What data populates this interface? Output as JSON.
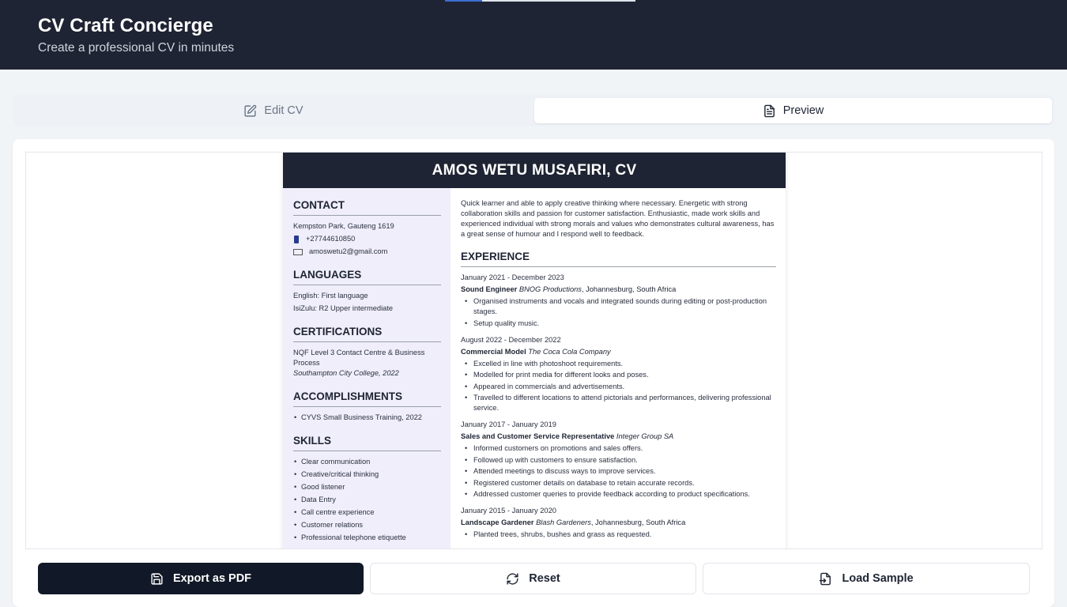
{
  "header": {
    "title": "CV Craft Concierge",
    "subtitle": "Create a professional CV in minutes"
  },
  "tabs": {
    "edit": "Edit CV",
    "preview": "Preview",
    "active": "Preview"
  },
  "cv": {
    "name": "AMOS WETU MUSAFIRI, CV",
    "contact": {
      "title": "CONTACT",
      "address": "Kempston Park, Gauteng 1619",
      "phone": "+27744610850",
      "email": "amoswetu2@gmail.com"
    },
    "languages": {
      "title": "LANGUAGES",
      "items": [
        "English: First language",
        "IsiZulu: R2 Upper intermediate"
      ]
    },
    "certifications": {
      "title": "CERTIFICATIONS",
      "name": "NQF Level 3 Contact Centre & Business Process",
      "institution": "Southampton City College, 2022"
    },
    "accomplishments": {
      "title": "ACCOMPLISHMENTS",
      "items": [
        "CYVS Small Business Training, 2022"
      ]
    },
    "skills": {
      "title": "SKILLS",
      "items": [
        "Clear communication",
        "Creative/critical thinking",
        "Good listener",
        "Data Entry",
        "Call centre experience",
        "Customer relations",
        "Professional telephone etiquette"
      ]
    },
    "summary": "Quick learner and able to apply creative thinking where necessary. Energetic with strong collaboration skills and passion for customer satisfaction. Enthusiastic, made work skills and experienced individual with strong morals and values who demonstrates cultural awareness, has a great sense of humour and I respond well to feedback.",
    "experience": {
      "title": "EXPERIENCE",
      "jobs": [
        {
          "dates": "January 2021 - December 2023",
          "role": "Sound Engineer",
          "company": "BNOG Productions",
          "location": ", Johannesburg, South Africa",
          "bullets": [
            "Organised instruments and vocals and integrated sounds during editing or post-production stages.",
            "Setup quality music."
          ]
        },
        {
          "dates": "August 2022 - December 2022",
          "role": "Commercial Model",
          "company": "The Coca Cola Company",
          "location": "",
          "bullets": [
            "Excelled in line with photoshoot requirements.",
            "Modelled for print media for different looks and poses.",
            "Appeared in commercials and advertisements.",
            "Travelled to different locations to attend pictorials and performances, delivering professional service."
          ]
        },
        {
          "dates": "January 2017 - January 2019",
          "role": "Sales and Customer Service Representative",
          "company": "Integer Group SA",
          "location": "",
          "bullets": [
            "Informed customers on promotions and sales offers.",
            "Followed up with customers to ensure satisfaction.",
            "Attended meetings to discuss ways to improve services.",
            "Registered customer details on database to retain accurate records.",
            "Addressed customer queries to provide feedback according to product specifications."
          ]
        },
        {
          "dates": "January 2015 - January 2020",
          "role": "Landscape Gardener",
          "company": "Blash Gardeners",
          "location": ", Johannesburg, South Africa",
          "bullets": [
            "Planted trees, shrubs, bushes and grass as requested."
          ]
        }
      ]
    }
  },
  "actions": {
    "export": "Export as PDF",
    "reset": "Reset",
    "load_sample": "Load Sample"
  },
  "icons": {
    "edit": "pencil-square-icon",
    "preview": "document-icon",
    "export": "save-icon",
    "reset": "refresh-icon",
    "load_sample": "file-import-icon"
  },
  "colors": {
    "header_bg": "#1e2433",
    "sidebar_bg": "#efeefa",
    "primary_button": "#111827"
  }
}
